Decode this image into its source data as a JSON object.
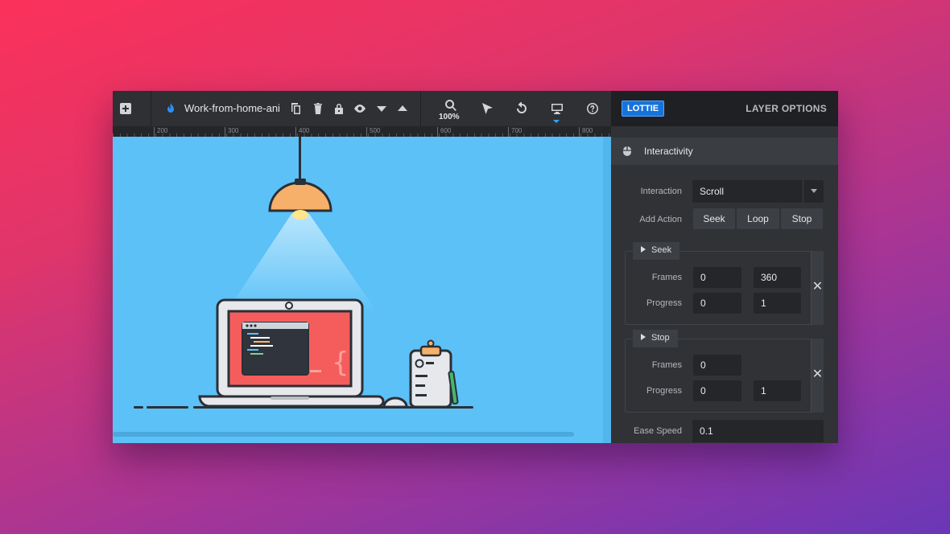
{
  "toolbar": {
    "file_name": "Work-from-home-ani",
    "zoom": "100%",
    "icons": [
      "add-layer-icon",
      "lottie-logo-icon",
      "duplicate-icon",
      "delete-icon",
      "lock-icon",
      "visibility-icon",
      "move-down-icon",
      "move-up-icon",
      "zoom-icon",
      "select-cursor-icon",
      "undo-icon",
      "desktop-preview-icon",
      "help-icon"
    ]
  },
  "ruler": {
    "ticks": [
      "200",
      "300",
      "400",
      "500",
      "600",
      "700",
      "800"
    ]
  },
  "panel": {
    "badge": "LOTTIE",
    "title": "LAYER OPTIONS",
    "section": "Interactivity",
    "interaction_label": "Interaction",
    "interaction_value": "Scroll",
    "add_action_label": "Add Action",
    "actions": [
      "Seek",
      "Loop",
      "Stop"
    ],
    "seek": {
      "title": "Seek",
      "frames_label": "Frames",
      "frames_from": "0",
      "frames_to": "360",
      "progress_label": "Progress",
      "progress_from": "0",
      "progress_to": "1",
      "close": "✕"
    },
    "stop": {
      "title": "Stop",
      "frames_label": "Frames",
      "frames_value": "0",
      "progress_label": "Progress",
      "progress_from": "0",
      "progress_to": "1",
      "close": "✕"
    },
    "ease_label": "Ease Speed",
    "ease_value": "0.1"
  },
  "colors": {
    "accent": "#1573dc",
    "canvas_bg": "#5bc1f7",
    "lamp": "#f7b069",
    "screen": "#f55d5d"
  }
}
